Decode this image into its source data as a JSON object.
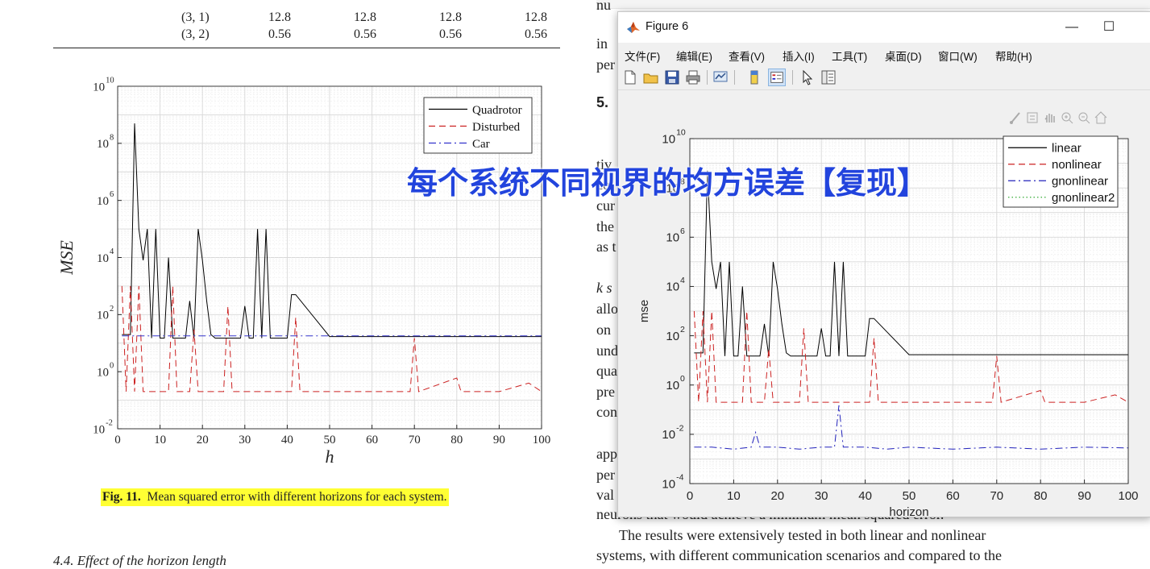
{
  "table": {
    "rows": [
      {
        "label": "(3, 1)",
        "values": [
          "12.8",
          "12.8",
          "12.8",
          "12.8"
        ]
      },
      {
        "label": "(3, 2)",
        "values": [
          "0.56",
          "0.56",
          "0.56",
          "0.56"
        ]
      }
    ]
  },
  "paper_chart": {
    "ylabel": "MSE",
    "xlabel": "h",
    "yticks": [
      "10",
      "10",
      "10",
      "10",
      "10",
      "10",
      "10"
    ],
    "ytick_exp": [
      "10",
      "8",
      "6",
      "4",
      "2",
      "0",
      "-2"
    ],
    "xticks": [
      "0",
      "10",
      "20",
      "30",
      "40",
      "50",
      "60",
      "70",
      "80",
      "90",
      "100"
    ],
    "legend": [
      "Quadrotor",
      "Disturbed",
      "Car"
    ]
  },
  "caption": {
    "label": "Fig. 11.",
    "text": "Mean squared error with different horizons for each system."
  },
  "section_heading": "4.4. Effect of the horizon length",
  "right_text": {
    "line_top1": "nu",
    "line_in": "in",
    "line_per": "per",
    "heading": "5.",
    "tiv": "tiv",
    "co": "co",
    "cur": "cur",
    "the": "the",
    "as": "as t",
    "ks": "k s",
    "allo": "allo",
    "on": "on",
    "und": "und",
    "qua": "qua",
    "pre": "pre",
    "con": "con",
    "app": "app",
    "per2": "per",
    "val": "val",
    "neurons": "neurons that would achieve a minimum mean squared error.",
    "results": "The results were extensively tested in both linear and nonlinear",
    "systems": "systems, with different communication scenarios and compared to the"
  },
  "figure_window": {
    "title": "Figure 6",
    "minimize": "—",
    "maximize": "☐",
    "menu": [
      "文件(F)",
      "编辑(E)",
      "查看(V)",
      "插入(I)",
      "工具(T)",
      "桌面(D)",
      "窗口(W)",
      "帮助(H)"
    ]
  },
  "overlay_title": "每个系统不同视界的均方误差【复现】",
  "chart_data": [
    {
      "type": "line",
      "title": "",
      "xlabel": "h",
      "ylabel": "MSE",
      "xlim": [
        0,
        100
      ],
      "ylim": [
        0.01,
        10000000000
      ],
      "yscale": "log",
      "grid": true,
      "legend_position": "top-right",
      "series": [
        {
          "name": "Quadrotor",
          "style": "solid",
          "color": "#000000",
          "points": [
            [
              1,
              20
            ],
            [
              2,
              20
            ],
            [
              3,
              20
            ],
            [
              4,
              500000000
            ],
            [
              5,
              100000
            ],
            [
              6,
              8000
            ],
            [
              7,
              100000
            ],
            [
              8,
              15
            ],
            [
              9,
              100000
            ],
            [
              10,
              15
            ],
            [
              11,
              15
            ],
            [
              12,
              10000
            ],
            [
              13,
              15
            ],
            [
              14,
              15
            ],
            [
              15,
              15
            ],
            [
              16,
              15
            ],
            [
              17,
              300
            ],
            [
              18,
              15
            ],
            [
              19,
              100000
            ],
            [
              20,
              8000
            ],
            [
              21,
              300
            ],
            [
              22,
              20
            ],
            [
              23,
              15
            ],
            [
              24,
              15
            ],
            [
              25,
              15
            ],
            [
              26,
              15
            ],
            [
              27,
              15
            ],
            [
              28,
              15
            ],
            [
              29,
              15
            ],
            [
              30,
              200
            ],
            [
              31,
              15
            ],
            [
              32,
              15
            ],
            [
              33,
              100000
            ],
            [
              34,
              15
            ],
            [
              35,
              100000
            ],
            [
              36,
              15
            ],
            [
              37,
              15
            ],
            [
              38,
              15
            ],
            [
              39,
              15
            ],
            [
              40,
              15
            ],
            [
              41,
              500
            ],
            [
              42,
              500
            ],
            [
              50,
              17
            ],
            [
              60,
              17
            ],
            [
              70,
              17
            ],
            [
              80,
              17
            ],
            [
              90,
              17
            ],
            [
              100,
              17
            ]
          ]
        },
        {
          "name": "Disturbed",
          "style": "dashed",
          "color": "#cc2222",
          "points": [
            [
              1,
              1000
            ],
            [
              2,
              0.2
            ],
            [
              3,
              1000
            ],
            [
              4,
              0.2
            ],
            [
              5,
              1000
            ],
            [
              6,
              0.2
            ],
            [
              7,
              0.2
            ],
            [
              8,
              0.2
            ],
            [
              9,
              0.2
            ],
            [
              10,
              0.2
            ],
            [
              11,
              0.2
            ],
            [
              12,
              0.2
            ],
            [
              13,
              1000
            ],
            [
              14,
              0.2
            ],
            [
              15,
              0.2
            ],
            [
              16,
              0.2
            ],
            [
              17,
              0.2
            ],
            [
              18,
              30
            ],
            [
              19,
              0.2
            ],
            [
              20,
              0.2
            ],
            [
              21,
              0.2
            ],
            [
              22,
              0.2
            ],
            [
              23,
              0.2
            ],
            [
              24,
              0.2
            ],
            [
              25,
              0.2
            ],
            [
              26,
              200
            ],
            [
              27,
              0.2
            ],
            [
              28,
              0.2
            ],
            [
              29,
              0.2
            ],
            [
              30,
              0.2
            ],
            [
              31,
              0.2
            ],
            [
              32,
              0.2
            ],
            [
              33,
              0.2
            ],
            [
              34,
              0.2
            ],
            [
              35,
              0.2
            ],
            [
              36,
              0.2
            ],
            [
              37,
              0.2
            ],
            [
              38,
              0.2
            ],
            [
              39,
              0.2
            ],
            [
              40,
              0.2
            ],
            [
              41,
              0.2
            ],
            [
              42,
              80
            ],
            [
              43,
              0.2
            ],
            [
              50,
              0.2
            ],
            [
              60,
              0.2
            ],
            [
              69,
              0.2
            ],
            [
              70,
              15
            ],
            [
              71,
              0.2
            ],
            [
              80,
              0.6
            ],
            [
              81,
              0.2
            ],
            [
              90,
              0.2
            ],
            [
              97,
              0.4
            ],
            [
              100,
              0.2
            ]
          ]
        },
        {
          "name": "Car",
          "style": "dashdot",
          "color": "#3333cc",
          "points": [
            [
              1,
              18
            ],
            [
              10,
              18
            ],
            [
              20,
              18
            ],
            [
              30,
              18
            ],
            [
              40,
              18
            ],
            [
              50,
              18
            ],
            [
              60,
              18
            ],
            [
              70,
              18
            ],
            [
              80,
              18
            ],
            [
              90,
              18
            ],
            [
              100,
              18
            ]
          ]
        }
      ]
    },
    {
      "type": "line",
      "title": "",
      "xlabel": "horizon",
      "ylabel": "mse",
      "xlim": [
        0,
        100
      ],
      "ylim": [
        0.0001,
        10000000000
      ],
      "yscale": "log",
      "grid": true,
      "legend_position": "top-right",
      "series": [
        {
          "name": "linear",
          "style": "solid",
          "color": "#000000",
          "points": [
            [
              1,
              20
            ],
            [
              2,
              20
            ],
            [
              3,
              20
            ],
            [
              4,
              500000000
            ],
            [
              5,
              100000
            ],
            [
              6,
              8000
            ],
            [
              7,
              100000
            ],
            [
              8,
              15
            ],
            [
              9,
              100000
            ],
            [
              10,
              15
            ],
            [
              11,
              15
            ],
            [
              12,
              10000
            ],
            [
              13,
              15
            ],
            [
              14,
              15
            ],
            [
              15,
              15
            ],
            [
              16,
              15
            ],
            [
              17,
              300
            ],
            [
              18,
              15
            ],
            [
              19,
              100000
            ],
            [
              20,
              8000
            ],
            [
              21,
              300
            ],
            [
              22,
              20
            ],
            [
              23,
              15
            ],
            [
              24,
              15
            ],
            [
              25,
              15
            ],
            [
              26,
              15
            ],
            [
              27,
              15
            ],
            [
              28,
              15
            ],
            [
              29,
              15
            ],
            [
              30,
              200
            ],
            [
              31,
              15
            ],
            [
              32,
              15
            ],
            [
              33,
              100000
            ],
            [
              34,
              15
            ],
            [
              35,
              100000
            ],
            [
              36,
              15
            ],
            [
              37,
              15
            ],
            [
              38,
              15
            ],
            [
              39,
              15
            ],
            [
              40,
              15
            ],
            [
              41,
              500
            ],
            [
              42,
              500
            ],
            [
              50,
              17
            ],
            [
              60,
              17
            ],
            [
              70,
              17
            ],
            [
              80,
              17
            ],
            [
              90,
              17
            ],
            [
              100,
              17
            ]
          ]
        },
        {
          "name": "nonlinear",
          "style": "dashed",
          "color": "#cc2222",
          "points": [
            [
              1,
              1000
            ],
            [
              2,
              0.2
            ],
            [
              3,
              1000
            ],
            [
              4,
              0.2
            ],
            [
              5,
              1000
            ],
            [
              6,
              0.2
            ],
            [
              7,
              0.2
            ],
            [
              8,
              0.2
            ],
            [
              9,
              0.2
            ],
            [
              10,
              0.2
            ],
            [
              11,
              0.2
            ],
            [
              12,
              0.2
            ],
            [
              13,
              1000
            ],
            [
              14,
              0.2
            ],
            [
              15,
              0.2
            ],
            [
              16,
              0.2
            ],
            [
              17,
              0.2
            ],
            [
              18,
              30
            ],
            [
              19,
              0.2
            ],
            [
              20,
              0.2
            ],
            [
              21,
              0.2
            ],
            [
              22,
              0.2
            ],
            [
              23,
              0.2
            ],
            [
              24,
              0.2
            ],
            [
              25,
              0.2
            ],
            [
              26,
              200
            ],
            [
              27,
              0.2
            ],
            [
              28,
              0.2
            ],
            [
              29,
              0.2
            ],
            [
              30,
              0.2
            ],
            [
              31,
              0.2
            ],
            [
              32,
              0.2
            ],
            [
              33,
              0.2
            ],
            [
              34,
              0.2
            ],
            [
              35,
              0.2
            ],
            [
              36,
              0.2
            ],
            [
              37,
              0.2
            ],
            [
              38,
              0.2
            ],
            [
              39,
              0.2
            ],
            [
              40,
              0.2
            ],
            [
              41,
              0.2
            ],
            [
              42,
              80
            ],
            [
              43,
              0.2
            ],
            [
              50,
              0.2
            ],
            [
              60,
              0.2
            ],
            [
              69,
              0.2
            ],
            [
              70,
              15
            ],
            [
              71,
              0.2
            ],
            [
              80,
              0.6
            ],
            [
              81,
              0.2
            ],
            [
              90,
              0.2
            ],
            [
              97,
              0.4
            ],
            [
              100,
              0.2
            ]
          ]
        },
        {
          "name": "gnonlinear",
          "style": "dashdot",
          "color": "#2222bb",
          "points": [
            [
              1,
              0.003
            ],
            [
              5,
              0.003
            ],
            [
              10,
              0.0025
            ],
            [
              14,
              0.003
            ],
            [
              15,
              0.012
            ],
            [
              16,
              0.003
            ],
            [
              20,
              0.003
            ],
            [
              25,
              0.0025
            ],
            [
              30,
              0.003
            ],
            [
              33,
              0.003
            ],
            [
              34,
              0.15
            ],
            [
              35,
              0.003
            ],
            [
              40,
              0.003
            ],
            [
              45,
              0.0025
            ],
            [
              50,
              0.003
            ],
            [
              60,
              0.0025
            ],
            [
              70,
              0.003
            ],
            [
              80,
              0.0025
            ],
            [
              90,
              0.003
            ],
            [
              100,
              0.0028
            ]
          ]
        },
        {
          "name": "gnonlinear2",
          "style": "dotted",
          "color": "#33aa33",
          "points": []
        }
      ]
    }
  ]
}
